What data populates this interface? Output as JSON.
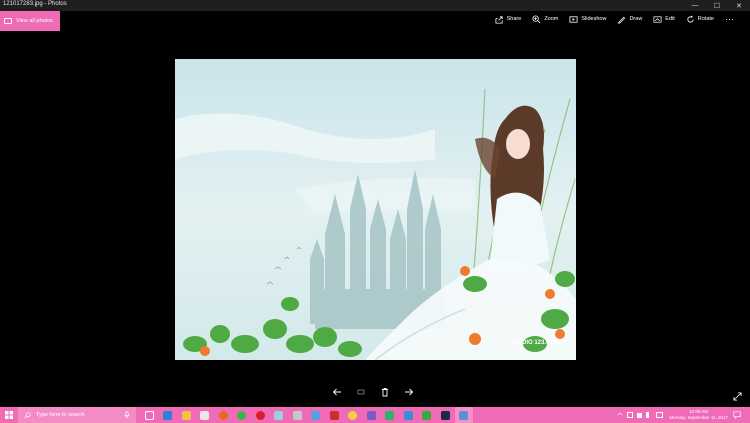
{
  "window": {
    "title": "121017283.jpg - Photos",
    "minimize": "—",
    "maximize": "☐",
    "close": "✕"
  },
  "header": {
    "view_all_label": "View all photos"
  },
  "toolbar": {
    "share": "Share",
    "zoom": "Zoom",
    "slideshow": "Slideshow",
    "draw": "Draw",
    "edit": "Edit",
    "rotate": "Rotate",
    "more": "···"
  },
  "photo": {
    "watermark": "STUDIO 123.COM"
  },
  "taskbar": {
    "search_placeholder": "Type here to search",
    "apps": [
      "task-view",
      "edge",
      "file-explorer",
      "store",
      "firefox",
      "chrome",
      "opera",
      "photos",
      "settings",
      "mail",
      "filezilla",
      "weather",
      "maps",
      "chat",
      "security",
      "onenote",
      "photoshop",
      "photos-active"
    ],
    "clock_time": "12:09 AM",
    "clock_date": "Monday, September 11, 2017"
  },
  "colors": {
    "accent": "#f06bb5",
    "titlebar": "#1f1f1f",
    "background": "#000000"
  }
}
